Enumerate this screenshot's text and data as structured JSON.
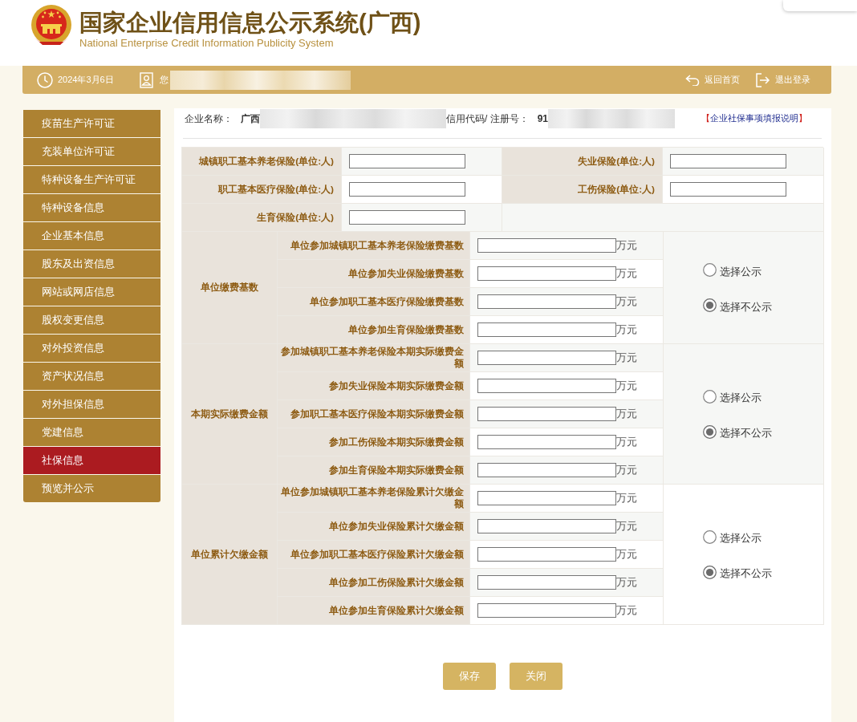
{
  "header": {
    "title": "国家企业信用信息公示系统(广西)",
    "subtitle": "National Enterprise Credit Information Publicity System"
  },
  "top_bar": {
    "date": "2024年3月6日",
    "greeting": "您",
    "links": [
      {
        "kind": "home",
        "label": "返回首页"
      },
      {
        "kind": "logout",
        "label": "退出登录"
      }
    ]
  },
  "sidebar": {
    "items": [
      {
        "label": "疫苗生产许可证",
        "selected": false
      },
      {
        "label": "充装单位许可证",
        "selected": false
      },
      {
        "label": "特种设备生产许可证",
        "selected": false
      },
      {
        "label": "特种设备信息",
        "selected": false
      },
      {
        "label": "企业基本信息",
        "selected": false
      },
      {
        "label": "股东及出资信息",
        "selected": false
      },
      {
        "label": "网站或网店信息",
        "selected": false
      },
      {
        "label": "股权变更信息",
        "selected": false
      },
      {
        "label": "对外投资信息",
        "selected": false
      },
      {
        "label": "资产状况信息",
        "selected": false
      },
      {
        "label": "对外担保信息",
        "selected": false
      },
      {
        "label": "党建信息",
        "selected": false
      },
      {
        "label": "社保信息",
        "selected": true
      },
      {
        "label": "预览并公示",
        "selected": false
      }
    ]
  },
  "company": {
    "name_label": "企业名称：",
    "name_value": "广西",
    "code_label": "信用代码/ 注册号：",
    "code_value": "91",
    "help_link": {
      "open": "【",
      "text": "企业社保事项填报说明",
      "close": "】"
    }
  },
  "headcount": {
    "fields": [
      "城镇职工基本养老保险(单位:人)",
      "失业保险(单位:人)",
      "职工基本医疗保险(单位:人)",
      "工伤保险(单位:人)",
      "生育保险(单位:人)"
    ]
  },
  "sections": [
    {
      "title": "单位缴费基数",
      "fields": [
        {
          "label": "单位参加城镇职工基本养老保险缴费基数",
          "unit": "万元"
        },
        {
          "label": "单位参加失业保险缴费基数",
          "unit": "万元"
        },
        {
          "label": "单位参加职工基本医疗保险缴费基数",
          "unit": "万元"
        },
        {
          "label": "单位参加生育保险缴费基数",
          "unit": "万元"
        }
      ],
      "options": [
        {
          "label": "选择公示",
          "selected": false
        },
        {
          "label": "选择不公示",
          "selected": true
        }
      ]
    },
    {
      "title": "本期实际缴费金额",
      "fields": [
        {
          "label": "参加城镇职工基本养老保险本期实际缴费金额",
          "unit": "万元"
        },
        {
          "label": "参加失业保险本期实际缴费金额",
          "unit": "万元"
        },
        {
          "label": "参加职工基本医疗保险本期实际缴费金额",
          "unit": "万元"
        },
        {
          "label": "参加工伤保险本期实际缴费金额",
          "unit": "万元"
        },
        {
          "label": "参加生育保险本期实际缴费金额",
          "unit": "万元"
        }
      ],
      "options": [
        {
          "label": "选择公示",
          "selected": false
        },
        {
          "label": "选择不公示",
          "selected": true
        }
      ]
    },
    {
      "title": "单位累计欠缴金额",
      "fields": [
        {
          "label": "单位参加城镇职工基本养老保险累计欠缴金额",
          "unit": "万元"
        },
        {
          "label": "单位参加失业保险累计欠缴金额",
          "unit": "万元"
        },
        {
          "label": "单位参加职工基本医疗保险累计欠缴金额",
          "unit": "万元"
        },
        {
          "label": "单位参加工伤保险累计欠缴金额",
          "unit": "万元"
        },
        {
          "label": "单位参加生育保险累计欠缴金额",
          "unit": "万元"
        }
      ],
      "options": [
        {
          "label": "选择公示",
          "selected": false
        },
        {
          "label": "选择不公示",
          "selected": true
        }
      ]
    }
  ],
  "buttons": [
    "保存",
    "关闭"
  ]
}
